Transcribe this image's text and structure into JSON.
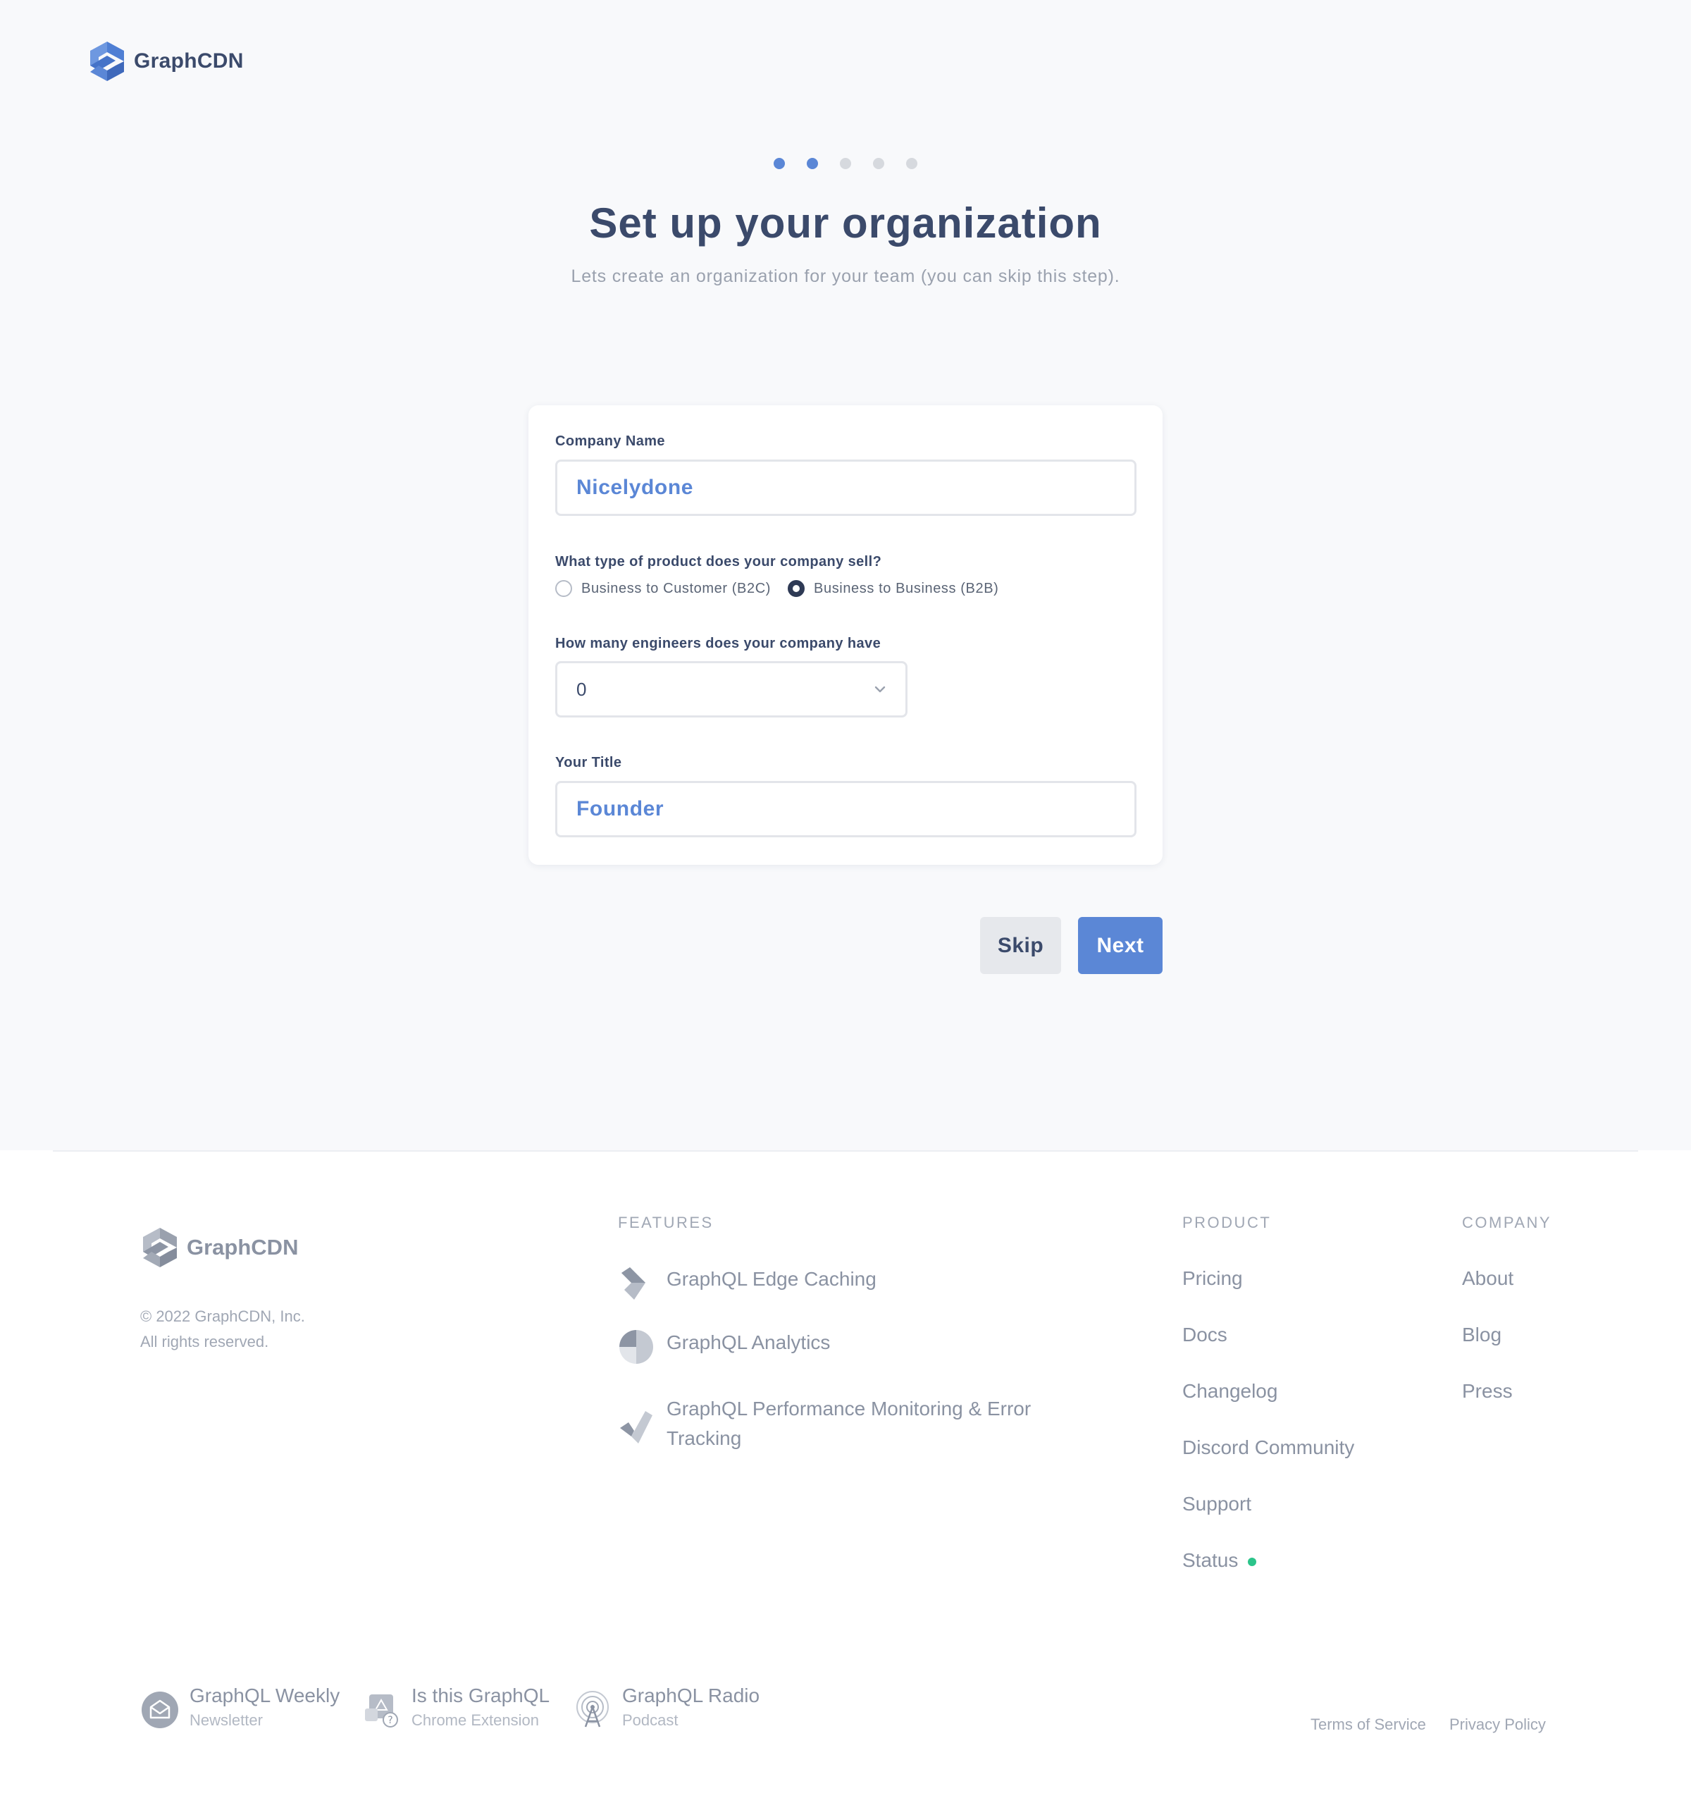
{
  "header": {
    "brand": "GraphCDN"
  },
  "steps": {
    "total": 5,
    "current": 2
  },
  "page": {
    "title": "Set up your organization",
    "subtitle": "Lets create an organization for your team (you can skip this step)."
  },
  "form": {
    "company_name": {
      "label": "Company Name",
      "value": "Nicelydone"
    },
    "product_type": {
      "label": "What type of product does your company sell?",
      "options": [
        "Business to Customer (B2C)",
        "Business to Business (B2B)"
      ],
      "selected": "Business to Business (B2B)"
    },
    "engineers": {
      "label": "How many engineers does your company have",
      "value": "0"
    },
    "title": {
      "label": "Your Title",
      "value": "Founder"
    }
  },
  "actions": {
    "skip": "Skip",
    "next": "Next"
  },
  "footer": {
    "brand": "GraphCDN",
    "copyright_line1": "© 2022 GraphCDN, Inc.",
    "copyright_line2": "All rights reserved.",
    "features_heading": "FEATURES",
    "features": [
      "GraphQL Edge Caching",
      "GraphQL Analytics",
      "GraphQL Performance Monitoring & Error Tracking"
    ],
    "product_heading": "PRODUCT",
    "product_links": [
      "Pricing",
      "Docs",
      "Changelog",
      "Discord Community",
      "Support",
      "Status"
    ],
    "company_heading": "COMPANY",
    "company_links": [
      "About",
      "Blog",
      "Press"
    ],
    "resources": [
      {
        "title": "GraphQL Weekly",
        "subtitle": "Newsletter"
      },
      {
        "title": "Is this GraphQL",
        "subtitle": "Chrome Extension"
      },
      {
        "title": "GraphQL Radio",
        "subtitle": "Podcast"
      }
    ],
    "legal": [
      "Terms of Service",
      "Privacy Policy"
    ]
  },
  "colors": {
    "accent": "#5b87d6",
    "text": "#3b4a6b",
    "muted": "#8a92a2",
    "status_ok": "#2bc48a"
  }
}
